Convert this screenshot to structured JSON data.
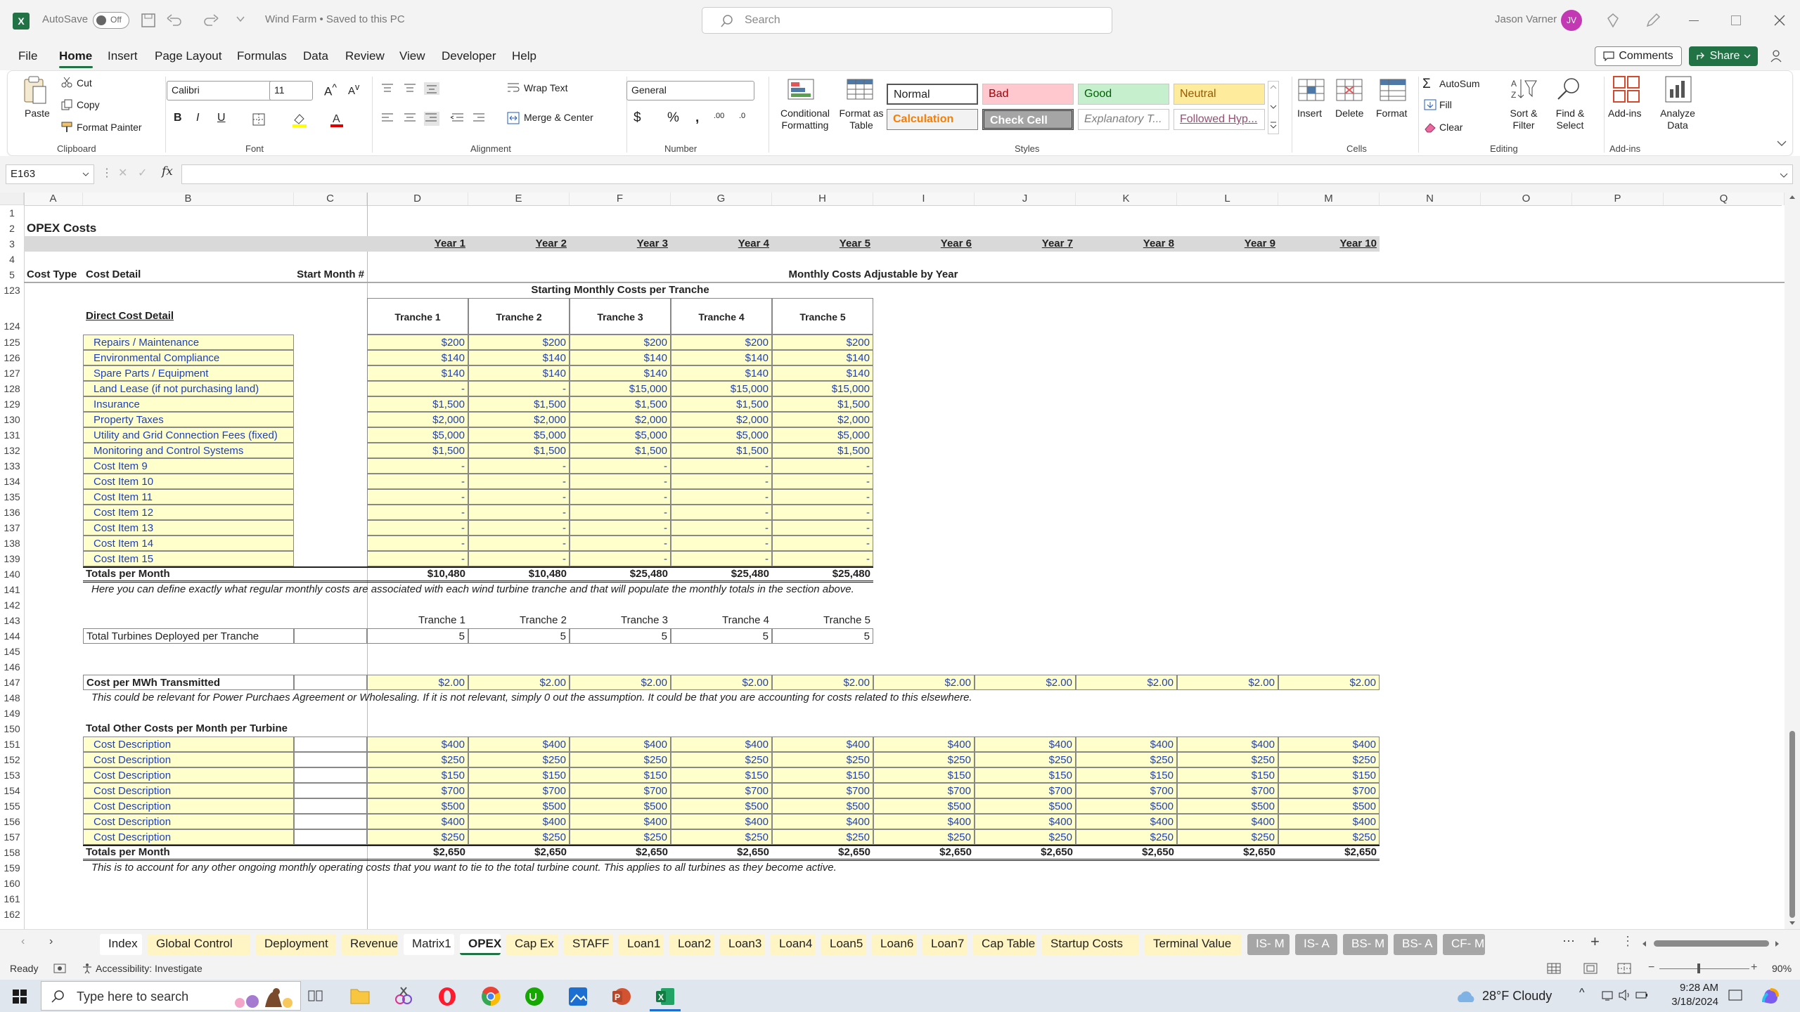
{
  "titlebar": {
    "autosave_label": "AutoSave",
    "autosave_state": "Off",
    "doc_title": "Wind Farm • Saved to this PC",
    "search_placeholder": "Search",
    "user_name": "Jason Varner",
    "user_initials": "JV"
  },
  "menu": {
    "items": [
      "File",
      "Home",
      "Insert",
      "Page Layout",
      "Formulas",
      "Data",
      "Review",
      "View",
      "Developer",
      "Help"
    ],
    "active": "Home",
    "comments": "Comments",
    "share": "Share"
  },
  "ribbon": {
    "clipboard": {
      "paste": "Paste",
      "cut": "Cut",
      "copy": "Copy",
      "format_painter": "Format Painter",
      "group": "Clipboard"
    },
    "font": {
      "name": "Calibri",
      "size": "11",
      "group": "Font",
      "bold": "B",
      "italic": "I",
      "underline": "U"
    },
    "alignment": {
      "wrap": "Wrap Text",
      "merge": "Merge & Center",
      "group": "Alignment"
    },
    "number": {
      "format": "General",
      "group": "Number"
    },
    "styles": {
      "conditional": "Conditional Formatting",
      "format_table": "Format as Table",
      "normal": "Normal",
      "bad": "Bad",
      "good": "Good",
      "neutral": "Neutral",
      "calculation": "Calculation",
      "check_cell": "Check Cell",
      "explanatory": "Explanatory T...",
      "followed": "Followed Hyp...",
      "group": "Styles"
    },
    "cells": {
      "insert": "Insert",
      "delete": "Delete",
      "format": "Format",
      "group": "Cells"
    },
    "editing": {
      "autosum": "AutoSum",
      "fill": "Fill",
      "clear": "Clear",
      "sort": "Sort & Filter",
      "find": "Find & Select",
      "group": "Editing"
    },
    "addins": {
      "addins": "Add-ins",
      "analyze": "Analyze Data",
      "group": "Add-ins"
    }
  },
  "formula_bar": {
    "name_box": "E163",
    "formula": ""
  },
  "columns": [
    "A",
    "B",
    "C",
    "D",
    "E",
    "F",
    "G",
    "H",
    "I",
    "J",
    "K",
    "L",
    "M",
    "N",
    "O",
    "P",
    "Q"
  ],
  "sheet": {
    "title": "OPEX Costs",
    "years": [
      "Year 1",
      "Year 2",
      "Year 3",
      "Year 4",
      "Year 5",
      "Year 6",
      "Year 7",
      "Year 8",
      "Year 9",
      "Year 10"
    ],
    "hdr_cost_type": "Cost Type",
    "hdr_cost_detail": "Cost Detail",
    "hdr_start_month": "Start Month #",
    "hdr_monthly": "Monthly Costs Adjustable by Year",
    "starting_monthly": "Starting Monthly Costs per Tranche",
    "direct_cost_detail": "Direct Cost Detail",
    "tranches": [
      "Tranche 1",
      "Tranche 2",
      "Tranche 3",
      "Tranche 4",
      "Tranche 5"
    ],
    "direct_rows": [
      {
        "r": "125",
        "label": "Repairs / Maintenance",
        "v": [
          "$200",
          "$200",
          "$200",
          "$200",
          "$200"
        ]
      },
      {
        "r": "126",
        "label": "Environmental Compliance",
        "v": [
          "$140",
          "$140",
          "$140",
          "$140",
          "$140"
        ]
      },
      {
        "r": "127",
        "label": "Spare Parts / Equipment",
        "v": [
          "$140",
          "$140",
          "$140",
          "$140",
          "$140"
        ]
      },
      {
        "r": "128",
        "label": "Land Lease (if not purchasing land)",
        "v": [
          "-",
          "-",
          "$15,000",
          "$15,000",
          "$15,000"
        ]
      },
      {
        "r": "129",
        "label": "Insurance",
        "v": [
          "$1,500",
          "$1,500",
          "$1,500",
          "$1,500",
          "$1,500"
        ]
      },
      {
        "r": "130",
        "label": "Property Taxes",
        "v": [
          "$2,000",
          "$2,000",
          "$2,000",
          "$2,000",
          "$2,000"
        ]
      },
      {
        "r": "131",
        "label": "Utility and Grid Connection Fees (fixed)",
        "v": [
          "$5,000",
          "$5,000",
          "$5,000",
          "$5,000",
          "$5,000"
        ]
      },
      {
        "r": "132",
        "label": "Monitoring and Control Systems",
        "v": [
          "$1,500",
          "$1,500",
          "$1,500",
          "$1,500",
          "$1,500"
        ]
      },
      {
        "r": "133",
        "label": "Cost Item 9",
        "v": [
          "-",
          "-",
          "-",
          "-",
          "-"
        ]
      },
      {
        "r": "134",
        "label": "Cost Item 10",
        "v": [
          "-",
          "-",
          "-",
          "-",
          "-"
        ]
      },
      {
        "r": "135",
        "label": "Cost Item 11",
        "v": [
          "-",
          "-",
          "-",
          "-",
          "-"
        ]
      },
      {
        "r": "136",
        "label": "Cost Item 12",
        "v": [
          "-",
          "-",
          "-",
          "-",
          "-"
        ]
      },
      {
        "r": "137",
        "label": "Cost Item 13",
        "v": [
          "-",
          "-",
          "-",
          "-",
          "-"
        ]
      },
      {
        "r": "138",
        "label": "Cost Item 14",
        "v": [
          "-",
          "-",
          "-",
          "-",
          "-"
        ]
      },
      {
        "r": "139",
        "label": "Cost Item 15",
        "v": [
          "-",
          "-",
          "-",
          "-",
          "-"
        ]
      }
    ],
    "totals_label": "Totals per Month",
    "direct_totals": [
      "$10,480",
      "$10,480",
      "$25,480",
      "$25,480",
      "$25,480"
    ],
    "note1": "Here you can define exactly what regular monthly costs are associated with each wind turbine tranche and that will populate the monthly totals in the section above.",
    "turbines_label": "Total Turbines Deployed per Tranche",
    "turbines": [
      "5",
      "5",
      "5",
      "5",
      "5"
    ],
    "mwh_label": "Cost per MWh Transmitted",
    "mwh": [
      "$2.00",
      "$2.00",
      "$2.00",
      "$2.00",
      "$2.00",
      "$2.00",
      "$2.00",
      "$2.00",
      "$2.00",
      "$2.00"
    ],
    "note2": "This could be relevant for Power Purchaes Agreement or Wholesaling. If it is not relevant, simply 0 out the assumption. It could be that you are accounting for costs related to this elsewhere.",
    "other_label": "Total Other Costs per Month per Turbine",
    "other_rows": [
      {
        "r": "151",
        "label": "Cost Description",
        "v": "$400"
      },
      {
        "r": "152",
        "label": "Cost Description",
        "v": "$250"
      },
      {
        "r": "153",
        "label": "Cost Description",
        "v": "$150"
      },
      {
        "r": "154",
        "label": "Cost Description",
        "v": "$700"
      },
      {
        "r": "155",
        "label": "Cost Description",
        "v": "$500"
      },
      {
        "r": "156",
        "label": "Cost Description",
        "v": "$400"
      },
      {
        "r": "157",
        "label": "Cost Description",
        "v": "$250"
      }
    ],
    "other_total": "$2,650",
    "note3": "This is to account for any other ongoing monthly operating costs that you want to tie to the total turbine count. This applies to all turbines as they become active."
  },
  "row_numbers_top": [
    "1",
    "2",
    "3",
    "4",
    "5",
    "123",
    "124"
  ],
  "row_numbers_after": [
    "140",
    "141",
    "142",
    "143",
    "144",
    "145",
    "146",
    "147",
    "148",
    "149",
    "150",
    "151",
    "152",
    "153",
    "154",
    "155",
    "156",
    "157",
    "158",
    "159",
    "160",
    "161",
    "162"
  ],
  "tabs": [
    {
      "label": "Index",
      "style": "white"
    },
    {
      "label": "Global Control",
      "style": "gold"
    },
    {
      "label": "Deployment",
      "style": "gold"
    },
    {
      "label": "Revenue",
      "style": "gold"
    },
    {
      "label": "Matrix1",
      "style": "white"
    },
    {
      "label": "OPEX",
      "style": "active"
    },
    {
      "label": "Cap Ex",
      "style": "gold"
    },
    {
      "label": "STAFF",
      "style": "gold"
    },
    {
      "label": "Loan1",
      "style": "gold"
    },
    {
      "label": "Loan2",
      "style": "gold"
    },
    {
      "label": "Loan3",
      "style": "gold"
    },
    {
      "label": "Loan4",
      "style": "gold"
    },
    {
      "label": "Loan5",
      "style": "gold"
    },
    {
      "label": "Loan6",
      "style": "gold"
    },
    {
      "label": "Loan7",
      "style": "gold"
    },
    {
      "label": "Cap Table",
      "style": "gold"
    },
    {
      "label": "Startup Costs",
      "style": "gold"
    },
    {
      "label": "Terminal Value",
      "style": "gold"
    },
    {
      "label": "IS- M",
      "style": "gray"
    },
    {
      "label": "IS- A",
      "style": "gray"
    },
    {
      "label": "BS- M",
      "style": "gray"
    },
    {
      "label": "BS- A",
      "style": "gray"
    },
    {
      "label": "CF- M",
      "style": "gray"
    }
  ],
  "status": {
    "ready": "Ready",
    "accessibility": "Accessibility: Investigate",
    "zoom": "90%"
  },
  "taskbar": {
    "search_placeholder": "Type here to search",
    "weather": "28°F  Cloudy",
    "time": "9:28 AM",
    "date": "3/18/2024"
  },
  "colors": {
    "excel_green": "#217346",
    "input_blue": "#1f3fbd",
    "input_yellow": "#ffffcc"
  }
}
